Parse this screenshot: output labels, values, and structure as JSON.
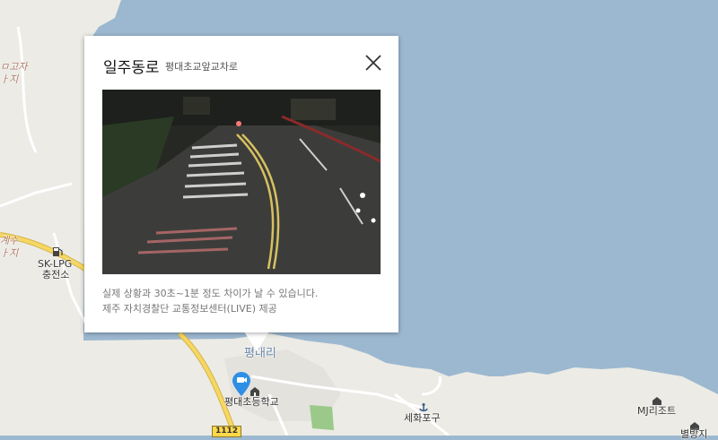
{
  "popup": {
    "title": "일주동로",
    "subtitle": "평대초교앞교차로",
    "notice_line1": "실제 상황과 30초~1분 정도 차이가 날 수 있습니다.",
    "notice_line2": "제주 자치경찰단 교통정보센터(LIVE) 제공",
    "close_icon": "close-icon",
    "camera_icon": "cctv-camera-icon"
  },
  "map": {
    "labels": {
      "gas_station_name": "SK-LPG",
      "gas_station_suffix": "충전소",
      "school": "평대초등학교",
      "port": "세화포구",
      "resort": "MJ리조트",
      "village": "평대리",
      "road_number": "1112",
      "edge_top_left_1": "ㅁ고자",
      "edge_top_left_2": "ㅏ지",
      "edge_mid_left_1": "계수",
      "edge_mid_left_2": "ㅏ지",
      "edge_bottom_right": "별방지"
    },
    "colors": {
      "sea": "#9cb8d0",
      "land": "#ecebe5",
      "road_main": "#f5d862",
      "road_casing": "#d8b24a",
      "park": "#9ac98a",
      "marker": "#2f8ee6"
    }
  }
}
